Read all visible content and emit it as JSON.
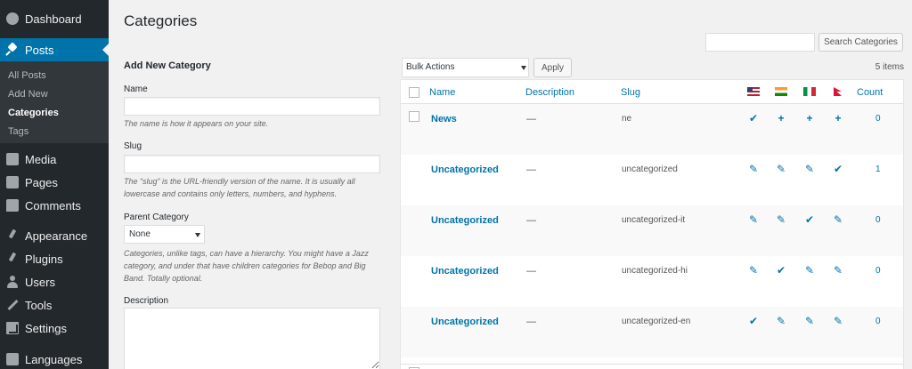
{
  "sidebar": {
    "items": [
      {
        "label": "Dashboard"
      },
      {
        "label": "Posts"
      },
      {
        "label": "Media"
      },
      {
        "label": "Pages"
      },
      {
        "label": "Comments"
      },
      {
        "label": "Appearance"
      },
      {
        "label": "Plugins"
      },
      {
        "label": "Users"
      },
      {
        "label": "Tools"
      },
      {
        "label": "Settings"
      },
      {
        "label": "Languages"
      }
    ],
    "submenu": [
      "All Posts",
      "Add New",
      "Categories",
      "Tags"
    ],
    "active_item": "Posts",
    "current_submenu": "Categories",
    "accent_color": "#0073aa"
  },
  "page": {
    "title": "Categories"
  },
  "search": {
    "placeholder": "",
    "button_label": "Search Categories"
  },
  "form": {
    "heading": "Add New Category",
    "name_label": "Name",
    "name_hint": "The name is how it appears on your site.",
    "slug_label": "Slug",
    "slug_hint": "The “slug” is the URL-friendly version of the name. It is usually all lowercase and contains only letters, numbers, and hyphens.",
    "parent_label": "Parent Category",
    "parent_value": "None",
    "parent_hint": "Categories, unlike tags, can have a hierarchy. You might have a Jazz category, and under that have children categories for Bebop and Big Band. Totally optional.",
    "description_label": "Description"
  },
  "table": {
    "bulk_action": "Bulk Actions",
    "apply_label": "Apply",
    "items_count": "5 items",
    "columns": {
      "name": "Name",
      "description": "Description",
      "slug": "Slug",
      "count": "Count"
    },
    "language_flags": [
      "us-flag-icon",
      "india-flag-icon",
      "italy-flag-icon",
      "nepal-flag-icon"
    ],
    "rows": [
      {
        "name": "News",
        "description": "—",
        "slug": "ne",
        "langs": [
          "✔",
          "+",
          "+",
          "+"
        ],
        "count": "0"
      },
      {
        "name": "Uncategorized",
        "description": "—",
        "slug": "uncategorized",
        "langs": [
          "✎",
          "✎",
          "✎",
          "✔"
        ],
        "count": "1"
      },
      {
        "name": "Uncategorized",
        "description": "—",
        "slug": "uncategorized-it",
        "langs": [
          "✎",
          "✎",
          "✔",
          "✎"
        ],
        "count": "0"
      },
      {
        "name": "Uncategorized",
        "description": "—",
        "slug": "uncategorized-hi",
        "langs": [
          "✎",
          "✔",
          "✎",
          "✎"
        ],
        "count": "0"
      },
      {
        "name": "Uncategorized",
        "description": "—",
        "slug": "uncategorized-en",
        "langs": [
          "✔",
          "✎",
          "✎",
          "✎"
        ],
        "count": "0"
      }
    ]
  }
}
